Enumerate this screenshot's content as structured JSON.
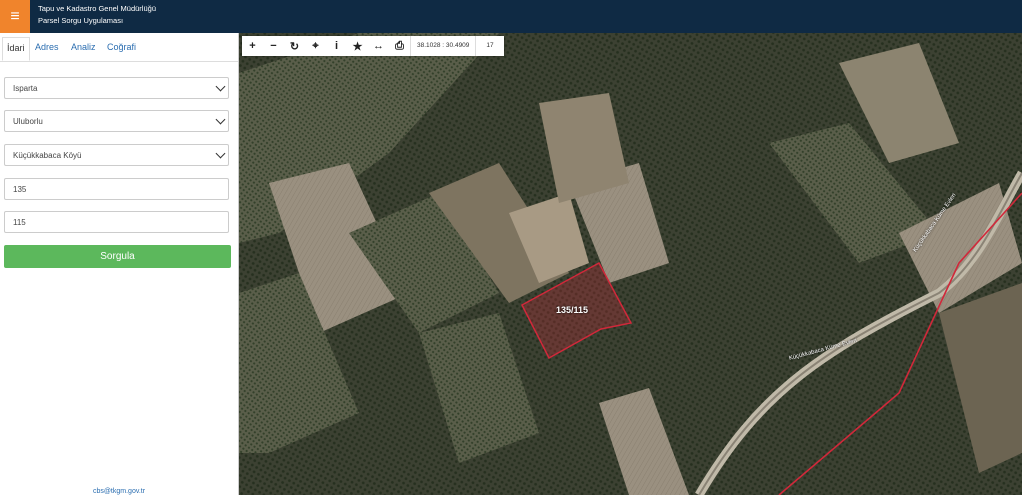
{
  "header": {
    "org": "Tapu ve Kadastro Genel Müdürlüğü",
    "app": "Parsel Sorgu Uygulaması",
    "menu_icon": "≡"
  },
  "tabs": [
    {
      "label": "İdari"
    },
    {
      "label": "Adres"
    },
    {
      "label": "Analiz"
    },
    {
      "label": "Coğrafi"
    }
  ],
  "form": {
    "il": "Isparta",
    "ilce": "Uluborlu",
    "mahalle": "Küçükkabaca Köyü",
    "ada": "135",
    "parsel": "115",
    "submit": "Sorgula"
  },
  "footer": {
    "email": "cbs@tkgm.gov.tr"
  },
  "map": {
    "coords": "38.1028 : 30.4909",
    "zoom": "17",
    "parcel_label": "135/115",
    "road_label_1": "Küçükkabaca Küme Evleri",
    "road_label_2": "Küçükkabaca Küme Evleri"
  },
  "colors": {
    "header": "#0f2a44",
    "accent": "#f0842c",
    "button": "#5cb85c",
    "parcel": "#d1283a"
  }
}
